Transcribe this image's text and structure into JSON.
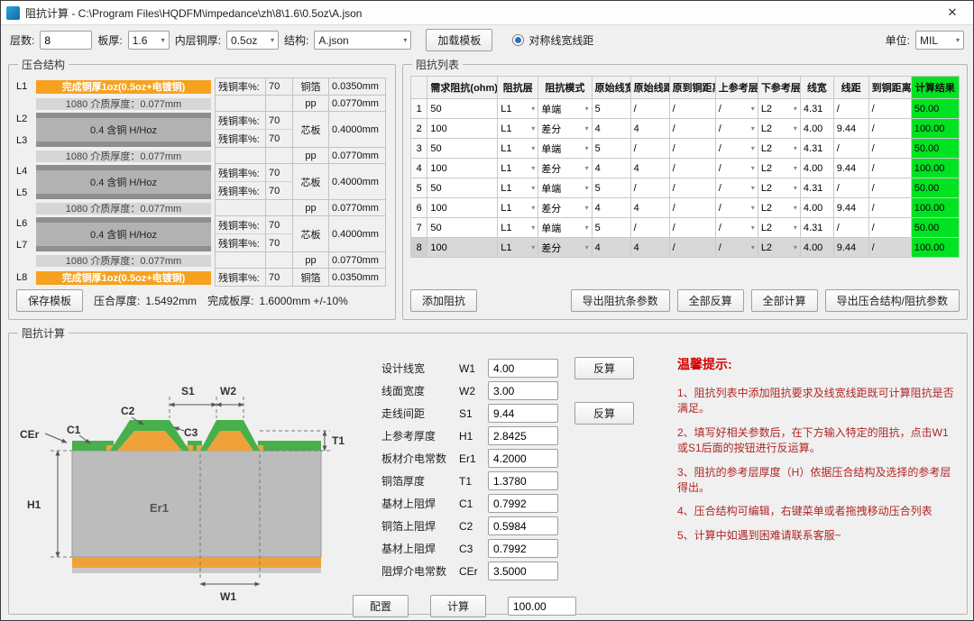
{
  "window": {
    "title": "阻抗计算 - C:\\Program Files\\HQDFM\\impedance\\zh\\8\\1.6\\0.5oz\\A.json",
    "close": "✕"
  },
  "icons": {
    "chevron_down": "▾",
    "close": "✕"
  },
  "toolbar": {
    "layers_label": "层数:",
    "layers_value": "8",
    "board_label": "板厚:",
    "board_value": "1.6",
    "copper_label": "内层铜厚:",
    "copper_value": "0.5oz",
    "structure_label": "结构:",
    "structure_value": "A.json",
    "load_template": "加载模板",
    "symmetric": "对称线宽线距",
    "unit_label": "单位:",
    "unit_value": "MIL"
  },
  "stackup": {
    "title": "压合结构",
    "rcl": "残铜率%:",
    "rows": [
      {
        "type": "foil",
        "layer": "L1",
        "bar": "完成铜厚1oz(0.5oz+电镀铜)",
        "rc": "70",
        "mat": "铜箔",
        "th": "0.0350mm"
      },
      {
        "type": "pp",
        "bar": "1080  介质厚度：0.077mm",
        "mat": "pp",
        "th": "0.0770mm"
      },
      {
        "type": "core",
        "l_top": "L2",
        "l_bot": "L3",
        "bar": "0.4 含铜 H/Hoz",
        "rc_top": "70",
        "rc_bot": "70",
        "mat": "芯板",
        "th": "0.4000mm"
      },
      {
        "type": "pp",
        "bar": "1080  介质厚度：0.077mm",
        "mat": "pp",
        "th": "0.0770mm"
      },
      {
        "type": "core",
        "l_top": "L4",
        "l_bot": "L5",
        "bar": "0.4 含铜 H/Hoz",
        "rc_top": "70",
        "rc_bot": "70",
        "mat": "芯板",
        "th": "0.4000mm"
      },
      {
        "type": "pp",
        "bar": "1080  介质厚度：0.077mm",
        "mat": "pp",
        "th": "0.0770mm"
      },
      {
        "type": "core",
        "l_top": "L6",
        "l_bot": "L7",
        "bar": "0.4 含铜 H/Hoz",
        "rc_top": "70",
        "rc_bot": "70",
        "mat": "芯板",
        "th": "0.4000mm"
      },
      {
        "type": "pp",
        "bar": "1080  介质厚度：0.077mm",
        "mat": "pp",
        "th": "0.0770mm"
      },
      {
        "type": "foil",
        "layer": "L8",
        "bar": "完成铜厚1oz(0.5oz+电镀铜)",
        "rc": "70",
        "mat": "铜箔",
        "th": "0.0350mm"
      }
    ],
    "save_template": "保存模板",
    "summary_1": "压合厚度:",
    "summary_1v": "1.5492mm",
    "summary_2": "完成板厚:",
    "summary_2v": "1.6000mm +/-10%"
  },
  "implist": {
    "title": "阻抗列表",
    "headers": [
      "需求阻抗(ohm)",
      "阻抗层",
      "阻抗模式",
      "原始线宽",
      "原始线距",
      "原到铜距离",
      "上参考层",
      "下参考层",
      "线宽",
      "线距",
      "到铜距离",
      "计算结果"
    ],
    "selected_row": 8,
    "rows": [
      {
        "num": "1",
        "req": "50",
        "layer": "L1",
        "mode": "单端",
        "ow": "5",
        "os": "/",
        "od": "/",
        "upref": "/",
        "dpref": "L2",
        "w": "4.31",
        "s": "/",
        "d": "/",
        "result": "50.00"
      },
      {
        "num": "2",
        "req": "100",
        "layer": "L1",
        "mode": "差分",
        "ow": "4",
        "os": "4",
        "od": "/",
        "upref": "/",
        "dpref": "L2",
        "w": "4.00",
        "s": "9.44",
        "d": "/",
        "result": "100.00"
      },
      {
        "num": "3",
        "req": "50",
        "layer": "L1",
        "mode": "单端",
        "ow": "5",
        "os": "/",
        "od": "/",
        "upref": "/",
        "dpref": "L2",
        "w": "4.31",
        "s": "/",
        "d": "/",
        "result": "50.00"
      },
      {
        "num": "4",
        "req": "100",
        "layer": "L1",
        "mode": "差分",
        "ow": "4",
        "os": "4",
        "od": "/",
        "upref": "/",
        "dpref": "L2",
        "w": "4.00",
        "s": "9.44",
        "d": "/",
        "result": "100.00"
      },
      {
        "num": "5",
        "req": "50",
        "layer": "L1",
        "mode": "单端",
        "ow": "5",
        "os": "/",
        "od": "/",
        "upref": "/",
        "dpref": "L2",
        "w": "4.31",
        "s": "/",
        "d": "/",
        "result": "50.00"
      },
      {
        "num": "6",
        "req": "100",
        "layer": "L1",
        "mode": "差分",
        "ow": "4",
        "os": "4",
        "od": "/",
        "upref": "/",
        "dpref": "L2",
        "w": "4.00",
        "s": "9.44",
        "d": "/",
        "result": "100.00"
      },
      {
        "num": "7",
        "req": "50",
        "layer": "L1",
        "mode": "单端",
        "ow": "5",
        "os": "/",
        "od": "/",
        "upref": "/",
        "dpref": "L2",
        "w": "4.31",
        "s": "/",
        "d": "/",
        "result": "50.00"
      },
      {
        "num": "8",
        "req": "100",
        "layer": "L1",
        "mode": "差分",
        "ow": "4",
        "os": "4",
        "od": "/",
        "upref": "/",
        "dpref": "L2",
        "w": "4.00",
        "s": "9.44",
        "d": "/",
        "result": "100.00"
      }
    ],
    "add": "添加阻抗",
    "export_params": "导出阻抗条参数",
    "reverse_all": "全部反算",
    "calc_all": "全部计算",
    "export_all": "导出压合结构/阻抗参数"
  },
  "calc": {
    "title": "阻抗计算",
    "fields": [
      {
        "label": "设计线宽",
        "sym": "W1",
        "value": "4.00",
        "btn": "反算"
      },
      {
        "label": "线面宽度",
        "sym": "W2",
        "value": "3.00"
      },
      {
        "label": "走线间距",
        "sym": "S1",
        "value": "9.44",
        "btn": "反算"
      },
      {
        "label": "上参考厚度",
        "sym": "H1",
        "value": "2.8425"
      },
      {
        "label": "板材介电常数",
        "sym": "Er1",
        "value": "4.2000"
      },
      {
        "label": "铜箔厚度",
        "sym": "T1",
        "value": "1.3780"
      },
      {
        "label": "基材上阻焊",
        "sym": "C1",
        "value": "0.7992"
      },
      {
        "label": "铜箔上阻焊",
        "sym": "C2",
        "value": "0.5984"
      },
      {
        "label": "基材上阻焊",
        "sym": "C3",
        "value": "0.7992"
      },
      {
        "label": "阻焊介电常数",
        "sym": "CEr",
        "value": "3.5000"
      }
    ],
    "config": "配置",
    "calculate": "计算",
    "target_value": "100.00",
    "diagram_labels": {
      "s1": "S1",
      "w2": "W2",
      "cer": "CEr",
      "c1": "C1",
      "c2": "C2",
      "c3": "C3",
      "t1": "T1",
      "h1": "H1",
      "er1": "Er1",
      "w1": "W1"
    }
  },
  "tips": {
    "title": "温馨提示:",
    "items": [
      "1、阻抗列表中添加阻抗要求及线宽线距既可计算阻抗是否满足。",
      "2、填写好相关参数后，在下方输入特定的阻抗，点击W1或S1后面的按钮进行反运算。",
      "3、阻抗的参考层厚度（H）依据压合结构及选择的参考层得出。",
      "4、压合结构可编辑，右键菜单或者拖拽移动压合列表",
      "5、计算中如遇到困难请联系客服~"
    ]
  }
}
